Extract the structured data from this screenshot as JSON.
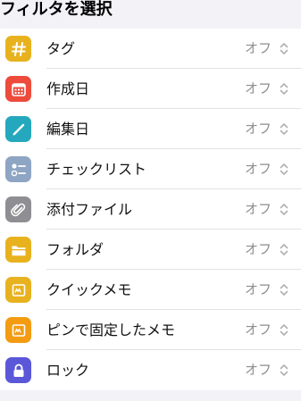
{
  "header": {
    "title": "フィルタを選択"
  },
  "filters": [
    {
      "label": "タグ",
      "value": "オフ",
      "icon": "hashtag-icon",
      "color": "#e8b21f"
    },
    {
      "label": "作成日",
      "value": "オフ",
      "icon": "calendar-icon",
      "color": "#ed4b3c"
    },
    {
      "label": "編集日",
      "value": "オフ",
      "icon": "pencil-icon",
      "color": "#25a8bd"
    },
    {
      "label": "チェックリスト",
      "value": "オフ",
      "icon": "checklist-icon",
      "color": "#8ea5c4"
    },
    {
      "label": "添付ファイル",
      "value": "オフ",
      "icon": "paperclip-icon",
      "color": "#8e8e93"
    },
    {
      "label": "フォルダ",
      "value": "オフ",
      "icon": "folder-icon",
      "color": "#e8b21f"
    },
    {
      "label": "クイックメモ",
      "value": "オフ",
      "icon": "quick-note-icon",
      "color": "#e8b21f"
    },
    {
      "label": "ピンで固定したメモ",
      "value": "オフ",
      "icon": "pinned-note-icon",
      "color": "#f39c12"
    },
    {
      "label": "ロック",
      "value": "オフ",
      "icon": "lock-icon",
      "color": "#5b57d9"
    }
  ]
}
